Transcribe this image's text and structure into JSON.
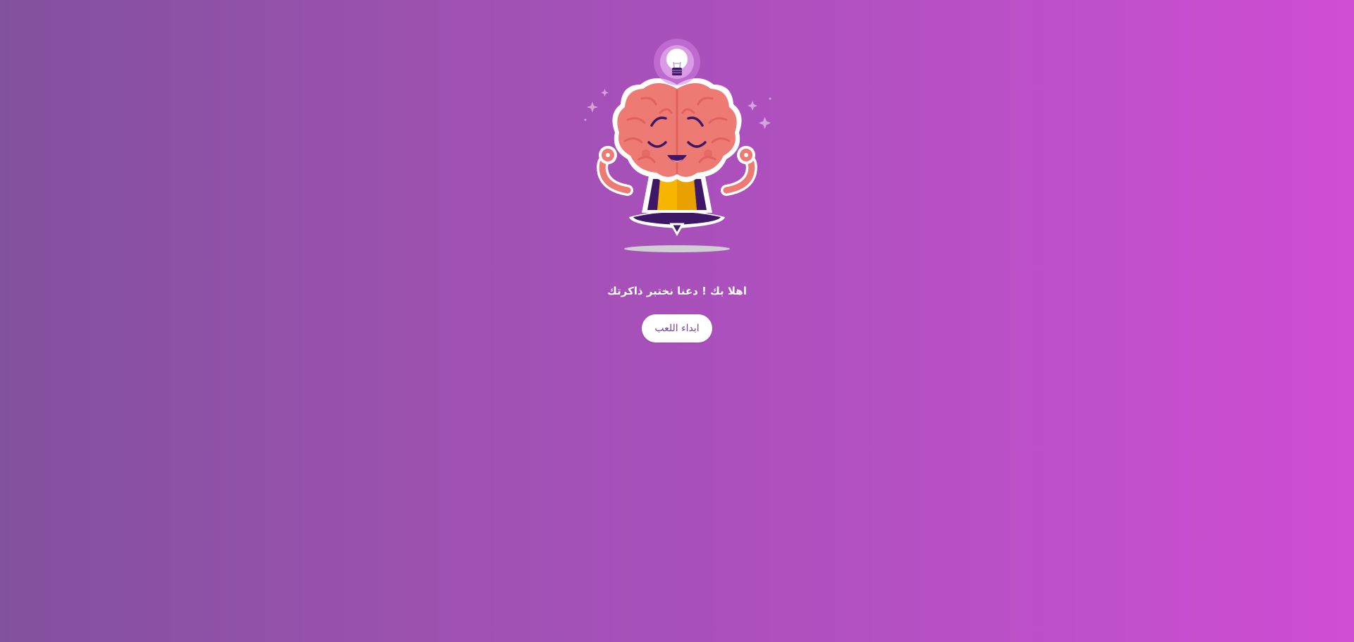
{
  "welcome_text": "اهلا بك ! دعنا نختبر ذاكرتك",
  "start_button_label": "ابداء اللعب",
  "colors": {
    "background_start": "#82519d",
    "background_end": "#cf4ed4",
    "brain": "#ee7a74",
    "brain_dark": "#e0615e",
    "shirt": "#f7b500",
    "pants": "#3e1766",
    "button_text": "#7e3fa0"
  },
  "icons": {
    "mascot": "meditating-brain-icon",
    "bulb": "lightbulb-icon"
  }
}
